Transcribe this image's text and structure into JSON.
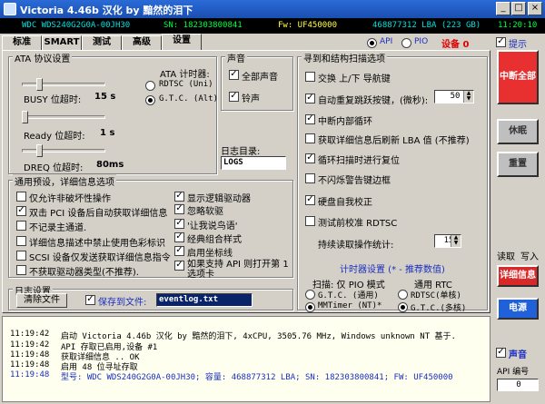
{
  "window": {
    "title": "Victoria 4.46b 汉化 by 黯然的泪下",
    "minimize_glyph": "_",
    "maximize_glyph": "□",
    "close_glyph": "×"
  },
  "infobar": {
    "model": "WDC WDS240G2G0A-00JH30",
    "serial": "SN: 182303800841",
    "firmware": "Fw: UF450000",
    "lba": "468877312 LBA (223 GB)",
    "device": "设备 0",
    "time": "11:20:10"
  },
  "tabs": [
    "标准",
    "SMART",
    "测试",
    "高级",
    "设置"
  ],
  "active_tab": "设置",
  "mode": {
    "api": "API",
    "pio": "PIO",
    "tip": "提示"
  },
  "ata": {
    "group": "ATA 协议设置",
    "timer_label": "ATA 计时器:",
    "rdtsc": "RDTSC (Uni)",
    "gtc": "G.T.C. (Alt)",
    "busy_label": "BUSY 位超时:",
    "busy_value": "15 s",
    "ready_label": "Ready 位超时:",
    "ready_value": "1 s",
    "dreq_label": "DREQ 位超时:",
    "dreq_value": "80ms"
  },
  "sound": {
    "group": "声音",
    "all": "全部声音",
    "bell": "铃声"
  },
  "log_dir": {
    "label": "日志目录:",
    "value": "LOGS"
  },
  "presets": {
    "group": "通用预设，详细信息选项",
    "left": [
      {
        "label": "仅允许非破坏性操作",
        "checked": false
      },
      {
        "label": "双击 PCI 设备后自动获取详细信息",
        "checked": true
      },
      {
        "label": "不记录主通道.",
        "checked": false
      },
      {
        "label": "详细信息描述中禁止使用色彩标识",
        "checked": false
      },
      {
        "label": "SCSI 设备仅发送获取详细信息指令",
        "checked": false
      },
      {
        "label": "不获取驱动器类型(不推荐).",
        "checked": false
      }
    ],
    "right": [
      {
        "label": "显示逻辑驱动器",
        "checked": true
      },
      {
        "label": "忽略软驱",
        "checked": true
      },
      {
        "label": "'让我说鸟语'",
        "checked": true
      },
      {
        "label": "经典组合样式",
        "checked": true
      },
      {
        "label": "启用坐标线",
        "checked": true
      },
      {
        "label": "如果支持 API 则打开第 1 选项卡",
        "checked": true
      }
    ]
  },
  "logset": {
    "group": "日志设置",
    "clear": "清除文件",
    "save_label": "保存到文件:",
    "save_checked": true,
    "filename": "eventlog.txt"
  },
  "scan": {
    "group": "寻到和结构扫描选项",
    "items": [
      {
        "label": "交换 上/下 导航键",
        "checked": false
      },
      {
        "label": "自动重复跳跃按键，(微秒):",
        "checked": true
      },
      {
        "label": "中断内部循环",
        "checked": true
      },
      {
        "label": "获取详细信息后刷新 LBA 值 (不推荐)",
        "checked": false
      },
      {
        "label": "循环扫描时进行复位",
        "checked": true
      },
      {
        "label": "不闪烁警告键边框",
        "checked": false
      },
      {
        "label": "硬盘自我校正",
        "checked": true
      },
      {
        "label": "测试前校准 RDTSC",
        "checked": false
      }
    ],
    "repeat_value": "50",
    "retry_label": "持续读取操作统计:",
    "retry_value": "15",
    "timer_title": "计时器设置 (* - 推荐数值)",
    "pio_title": "扫描: 仅 PIO 模式",
    "rtc_title": "通用 RTC",
    "pio_gtc": "G.T.C. (通用)",
    "pio_mm": "MMTimer (NT)*",
    "rtc_rdtsc": "RDTSC(单核)",
    "rtc_gtc": "G.T.C.(多核)"
  },
  "sidebar": {
    "break_all": "中断全部",
    "sleep": "休眠",
    "reset": "重置",
    "read": "读取",
    "write": "写入",
    "details": "详细信息",
    "power": "电源",
    "sound": "声音",
    "api_label": "API 编号",
    "api_value": "0"
  },
  "log": [
    {
      "time": "11:19:42",
      "msg": "启动 Victoria 4.46b 汉化 by 黯然的泪下, 4xCPU, 3505.76 MHz, Windows unknown NT 基于."
    },
    {
      "time": "11:19:42",
      "msg": "API 存取已启用,设备 #1"
    },
    {
      "time": "11:19:48",
      "msg": "获取详细信息 .. OK"
    },
    {
      "time": "11:19:48",
      "msg": "启用 48 位寻址存取"
    },
    {
      "time": "11:19:48",
      "msg": "型号:  WDC WDS240G2G0A-00JH30;    容量: 468877312 LBA; SN: 182303800841; FW: UF450000"
    }
  ],
  "colors": {
    "window_bg": "#d4d0c8",
    "title_blue": "#2a6bd8",
    "break_red": "#e83030",
    "sleep_gray": "#bfbfbf",
    "details_red": "#d82828",
    "power_blue": "#2060d8"
  }
}
